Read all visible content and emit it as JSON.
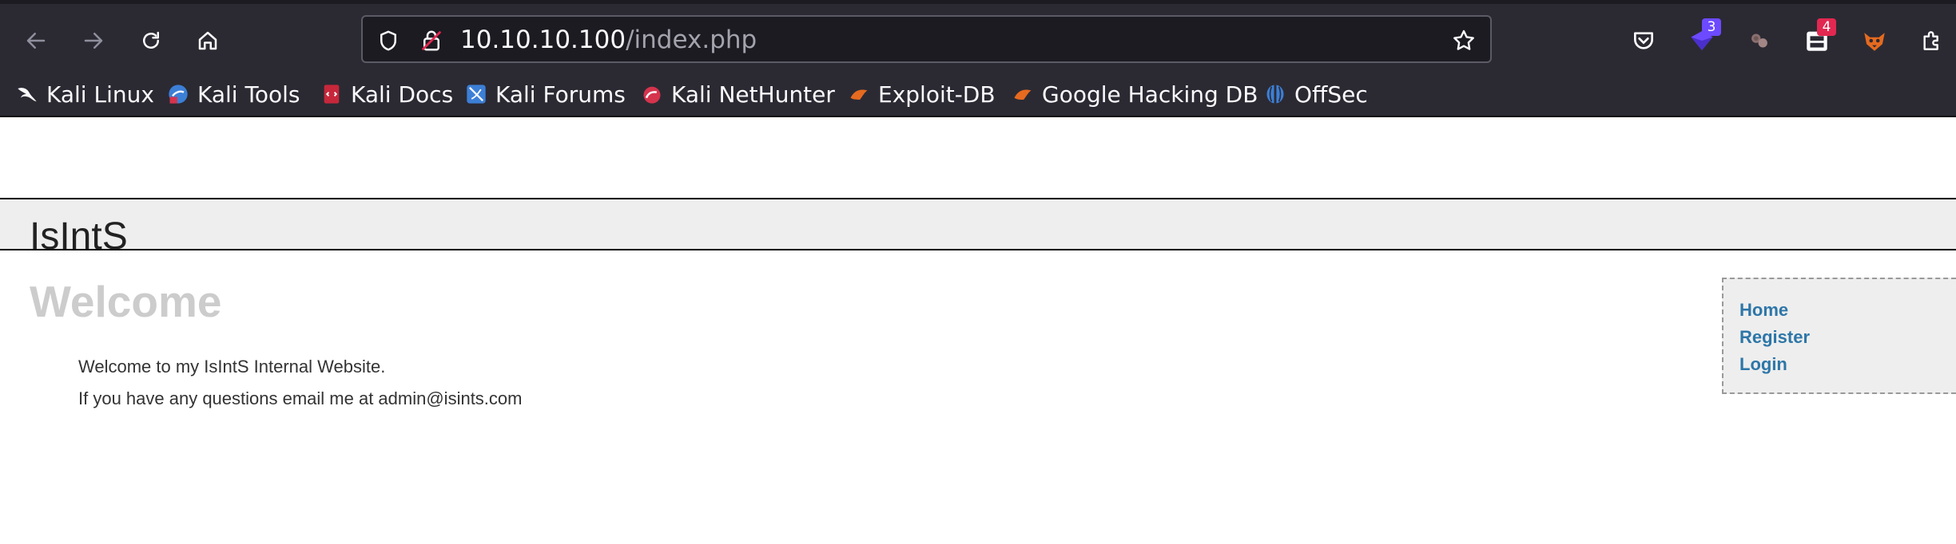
{
  "browser": {
    "url_host": "10.10.10.100",
    "url_path": "/index.php",
    "extensions": [
      {
        "name": "pocket-icon",
        "badge": ""
      },
      {
        "name": "proton-vpn-icon",
        "badge": "3",
        "badge_color": "#6d4aff"
      },
      {
        "name": "paw-extension-icon",
        "badge": ""
      },
      {
        "name": "screenshot-extension-icon",
        "badge": "4",
        "badge_color": "#e22850"
      },
      {
        "name": "foxyproxy-icon",
        "badge": ""
      },
      {
        "name": "extensions-puzzle-icon",
        "badge": ""
      }
    ],
    "bookmarks": [
      {
        "label": "Kali Linux",
        "icon": "kali-dragon-icon"
      },
      {
        "label": "Kali Tools",
        "icon": "kali-tools-icon"
      },
      {
        "label": "Kali Docs",
        "icon": "kali-docs-icon"
      },
      {
        "label": "Kali Forums",
        "icon": "kali-forums-icon"
      },
      {
        "label": "Kali NetHunter",
        "icon": "kali-nethunter-icon"
      },
      {
        "label": "Exploit-DB",
        "icon": "exploit-db-icon"
      },
      {
        "label": "Google Hacking DB",
        "icon": "google-hacking-db-icon"
      },
      {
        "label": "OffSec",
        "icon": "offsec-icon"
      }
    ]
  },
  "site": {
    "title": "IsIntS",
    "heading": "Welcome",
    "paragraphs": [
      "Welcome to my IsIntS Internal Website.",
      "If you have any questions email me at admin@isints.com"
    ],
    "menu": [
      {
        "label": "Home"
      },
      {
        "label": "Register"
      },
      {
        "label": "Login"
      }
    ]
  },
  "colors": {
    "chrome_bg": "#2b2a33",
    "url_bg": "#1c1b22",
    "link": "#2d76a8",
    "heading": "#cccccc"
  }
}
